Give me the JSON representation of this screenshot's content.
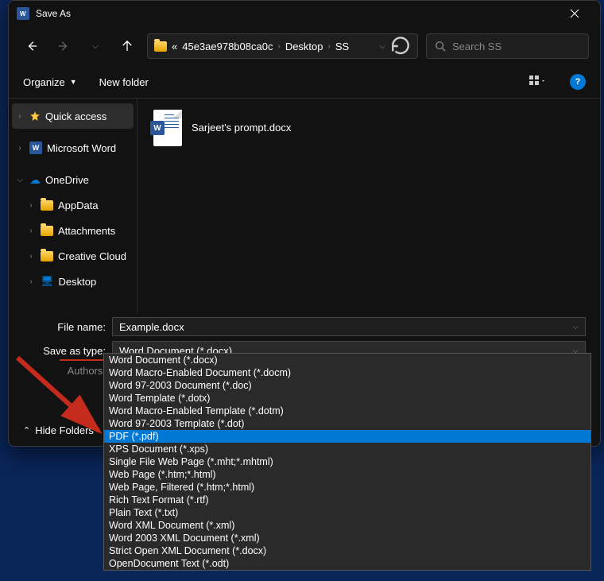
{
  "window": {
    "title": "Save As"
  },
  "path": {
    "prefix": "«",
    "seg1": "45e3ae978b08ca0c",
    "seg2": "Desktop",
    "seg3": "SS"
  },
  "search": {
    "placeholder": "Search SS"
  },
  "toolbar": {
    "organize": "Organize",
    "newfolder": "New folder"
  },
  "tree": {
    "quick": "Quick access",
    "word": "Microsoft Word",
    "onedrive": "OneDrive",
    "appdata": "AppData",
    "attachments": "Attachments",
    "creative": "Creative Cloud",
    "desktop": "Desktop"
  },
  "file": {
    "name": "Sarjeet's prompt.docx"
  },
  "fields": {
    "filename_label": "File name:",
    "filename_value": "Example.docx",
    "savetype_label": "Save as type:",
    "savetype_value": "Word Document (*.docx)",
    "authors_label": "Authors:"
  },
  "hidefolders": "Hide Folders",
  "dropdown": [
    "Word Document (*.docx)",
    "Word Macro-Enabled Document (*.docm)",
    "Word 97-2003 Document (*.doc)",
    "Word Template (*.dotx)",
    "Word Macro-Enabled Template (*.dotm)",
    "Word 97-2003 Template (*.dot)",
    "PDF (*.pdf)",
    "XPS Document (*.xps)",
    "Single File Web Page (*.mht;*.mhtml)",
    "Web Page (*.htm;*.html)",
    "Web Page, Filtered (*.htm;*.html)",
    "Rich Text Format (*.rtf)",
    "Plain Text (*.txt)",
    "Word XML Document (*.xml)",
    "Word 2003 XML Document (*.xml)",
    "Strict Open XML Document (*.docx)",
    "OpenDocument Text (*.odt)"
  ],
  "dropdown_selected": 6
}
